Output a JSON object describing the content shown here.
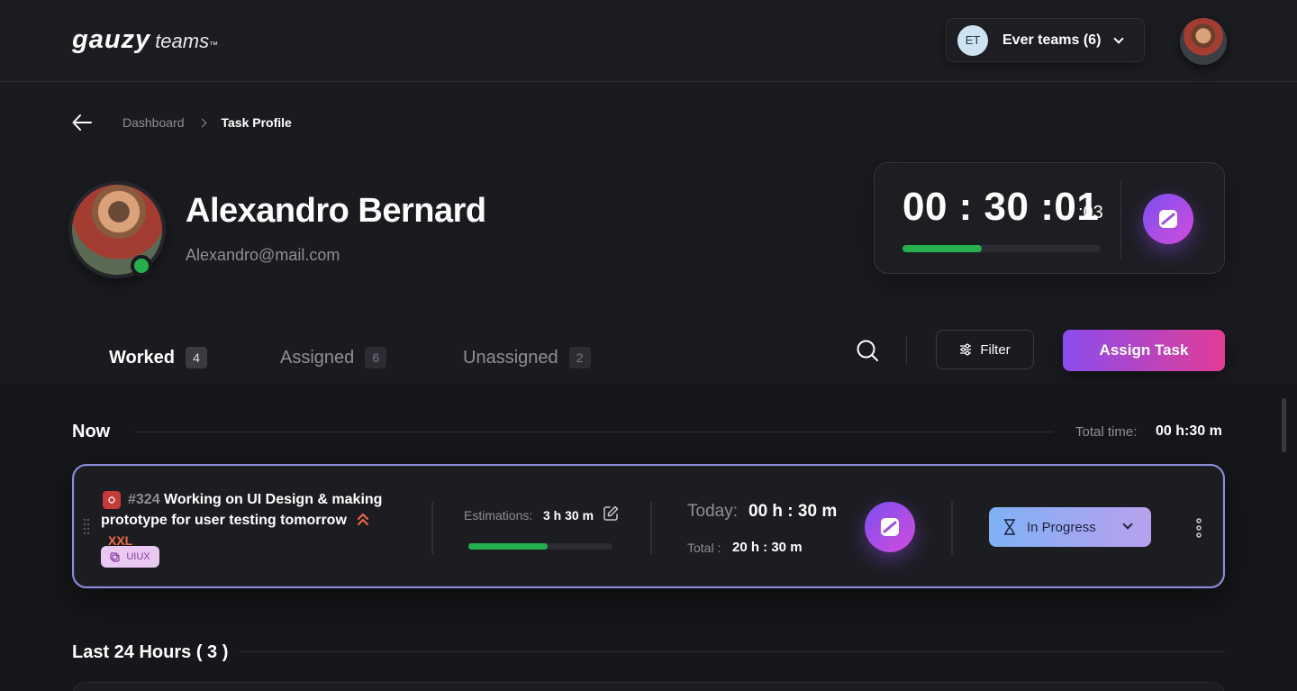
{
  "header": {
    "logo_brand": "gauzy",
    "logo_product": "teams",
    "logo_tm": "™",
    "team": {
      "initials": "ET",
      "name": "Ever teams (6)"
    }
  },
  "breadcrumb": {
    "items": [
      "Dashboard",
      "Task Profile"
    ]
  },
  "profile": {
    "name": "Alexandro Bernard",
    "email": "Alexandro@mail.com",
    "status_color": "#27ae4f"
  },
  "timer": {
    "main": "00 : 30 :01",
    "ms": ":03",
    "progress": 0.4,
    "progress_color": "#27ae4f"
  },
  "tabs": [
    {
      "label": "Worked",
      "count": "4",
      "active": true
    },
    {
      "label": "Assigned",
      "count": "6"
    },
    {
      "label": "Unassigned",
      "count": "2"
    }
  ],
  "toolbar": {
    "filter_label": "Filter",
    "assign_label": "Assign Task"
  },
  "now_section": {
    "title": "Now",
    "total_label": "Total time:",
    "total_value": "00 h:30 m"
  },
  "task": {
    "number": "#324",
    "title": "Working on UI Design & making",
    "title_line2": "prototype for user testing tomorrow",
    "size": "XXL",
    "tag": "UIUX",
    "estimation_label": "Estimations:",
    "estimation_value": "3 h 30 m",
    "estimation_progress": 0.55,
    "today_label": "Today:",
    "today_value": "00 h : 30 m",
    "total_label": "Total :",
    "total_value": "20 h : 30 m",
    "status": "In Progress"
  },
  "last24_section": {
    "title": "Last 24 Hours ( 3 )"
  },
  "colors": {
    "accent_gradient_start": "#8a4dec",
    "accent_gradient_end": "#e23c96",
    "background": "#1a1b1f",
    "bug": "#c23a3a",
    "size_xxl": "#f06a48"
  }
}
